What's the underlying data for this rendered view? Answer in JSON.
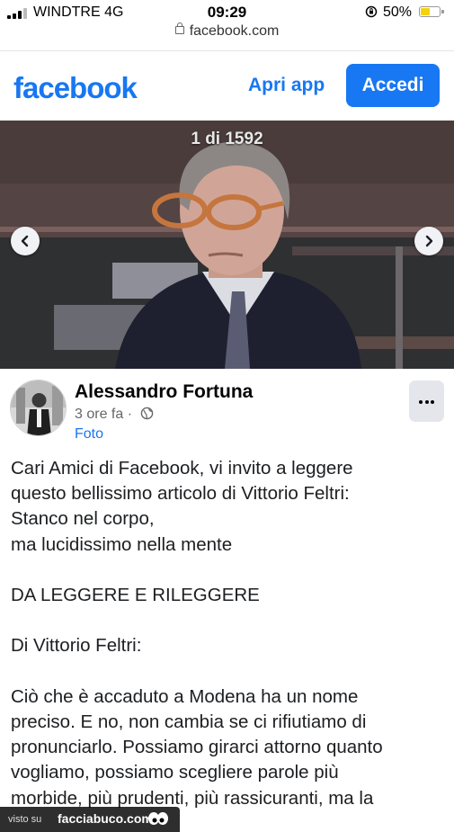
{
  "status_bar": {
    "carrier": "WINDTRE  4G",
    "time": "09:29",
    "battery_percent": "50%",
    "battery_level": 0.5
  },
  "browser": {
    "url": "facebook.com"
  },
  "header": {
    "logo": "facebook",
    "open_app_label": "Apri app",
    "login_label": "Accedi",
    "brand_color": "#1877f2"
  },
  "photo": {
    "counter": "1 di 1592",
    "prev_icon": "chevron-left-icon",
    "next_icon": "chevron-right-icon"
  },
  "post": {
    "author": "Alessandro Fortuna",
    "time_ago": "3 ore fa",
    "separator": "·",
    "privacy_icon": "globe-icon",
    "album": "Foto",
    "more_icon": "more-dots-icon",
    "lines": [
      "Cari Amici di Facebook, vi invito a leggere",
      "questo bellissimo articolo di Vittorio Feltri:",
      "Stanco nel corpo,",
      "ma lucidissimo nella mente",
      "",
      "DA LEGGERE E RILEGGERE",
      "",
      "Di Vittorio Feltri:",
      "",
      "Ciò che è accaduto a Modena ha un nome",
      "preciso. E no, non cambia se ci rifiutiamo di",
      "pronunciarlo. Possiamo girarci attorno quanto",
      "vogliamo, possiamo scegliere parole più",
      "morbide, più prudenti, più rassicuranti, ma la"
    ]
  },
  "watermark": {
    "prefix": "visto su",
    "site": "facciabuco.com"
  }
}
